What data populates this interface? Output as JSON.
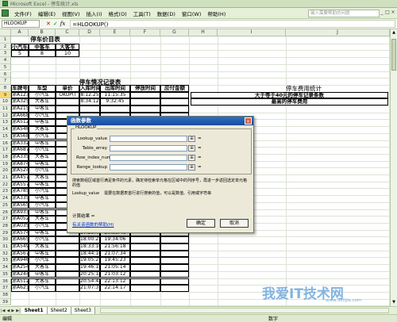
{
  "window": {
    "title": "Microsoft Excel - 停车统计.xls"
  },
  "menu": {
    "items": [
      "文件(F)",
      "编辑(E)",
      "视图(V)",
      "插入(I)",
      "格式(O)",
      "工具(T)",
      "数据(D)",
      "窗口(W)",
      "帮助(H)"
    ],
    "help_placeholder": "键入需要帮助的问题",
    "win_buttons": [
      "_",
      "□",
      "×"
    ]
  },
  "formula_bar": {
    "name_box": "HLOOKUP",
    "cancel_glyph": "✕",
    "enter_glyph": "✓",
    "fx_glyph": "fx",
    "formula": "=HLOOKUP()"
  },
  "columns": [
    "A",
    "B",
    "C",
    "D",
    "E",
    "F",
    "G",
    "H",
    "I",
    "J"
  ],
  "rows": [
    "1",
    "2",
    "3",
    "4",
    "5",
    "6",
    "7",
    "8",
    "9",
    "10",
    "11",
    "12",
    "13",
    "14",
    "15",
    "16",
    "17",
    "18",
    "19",
    "20",
    "21",
    "22",
    "23",
    "24",
    "25",
    "26",
    "27",
    "28",
    "29",
    "30",
    "31",
    "32",
    "33",
    "34",
    "35",
    "36",
    "37",
    "38",
    "39"
  ],
  "price_table": {
    "title": "停车价目表",
    "headers": [
      "小汽车",
      "中客车",
      "大客车"
    ],
    "values": [
      "5",
      "8",
      "10"
    ]
  },
  "record_table": {
    "title": "停车情况记录表",
    "headers": [
      "车牌号",
      "车型",
      "单价",
      "入库时间",
      "出库时间",
      "停放时间",
      "应付金额"
    ],
    "rows": [
      [
        "浙A12345",
        "小汽车",
        "OKUP()",
        "8:12:25",
        "11:15:35"
      ],
      [
        "浙A32581",
        "大客车",
        "",
        "8:34:12",
        "9:32:45"
      ],
      [
        "浙A21584",
        "中客车",
        "",
        "",
        ""
      ],
      [
        "浙A66871",
        "小汽车",
        "",
        "",
        ""
      ],
      [
        "浙A51271",
        "中客车",
        "",
        "",
        ""
      ],
      [
        "浙A54844",
        "大客车",
        "",
        "",
        ""
      ],
      [
        "浙A56894",
        "小汽车",
        "",
        "",
        ""
      ],
      [
        "浙A33221",
        "中客车",
        "",
        "",
        ""
      ],
      [
        "浙A68721",
        "小汽车",
        "",
        "",
        ""
      ],
      [
        "浙A33547",
        "大客车",
        "",
        "",
        ""
      ],
      [
        "浙A87412",
        "中客车",
        "",
        "",
        ""
      ],
      [
        "浙A52485",
        "小汽车",
        "",
        "",
        ""
      ],
      [
        "浙A45742",
        "大客车",
        "",
        "",
        ""
      ],
      [
        "浙A55711",
        "中客车",
        "",
        "",
        ""
      ],
      [
        "浙A78546",
        "小汽车",
        "",
        "",
        ""
      ],
      [
        "浙A33551",
        "中客车",
        "",
        "",
        ""
      ],
      [
        "浙A56587",
        "小汽车",
        "",
        "",
        ""
      ],
      [
        "浙A93355",
        "中客车",
        "",
        "",
        ""
      ],
      [
        "浙A05258",
        "大客车",
        "",
        "16:42:17",
        "21:05:14"
      ],
      [
        "浙A03552",
        "小汽车",
        "",
        "16:52:49",
        "19:03:00"
      ],
      [
        "浙A57484",
        "中客车",
        "",
        "17:29:49",
        "20:38:48"
      ],
      [
        "浙A66565",
        "小汽车",
        "",
        "18:00:21",
        "19:34:06"
      ],
      [
        "浙A54912",
        "大客车",
        "",
        "18:33:16",
        "21:56:18"
      ],
      [
        "浙A56786",
        "中客车",
        "",
        "18:44:16",
        "21:07:34"
      ],
      [
        "浙A94658",
        "小汽车",
        "",
        "19:05:21",
        "19:45:23"
      ],
      [
        "浙A25423",
        "大客车",
        "",
        "19:46:12",
        "21:05:14"
      ],
      [
        "浙A24422",
        "中客车",
        "",
        "20:25:14",
        "21:03:12"
      ],
      [
        "浙A51214",
        "大客车",
        "",
        "20:54:43",
        "22:13:12"
      ],
      [
        "浙A62347",
        "小汽车",
        "",
        "21:07:37",
        "22:14:17"
      ]
    ]
  },
  "stats": {
    "title": "停车费用统计",
    "row1": "大于等于40元的停车记录条数",
    "row2": "最高的停车费用"
  },
  "dialog": {
    "title": "函数参数",
    "close_glyph": "×",
    "group_label": "HLOOKUP",
    "args": [
      "Lookup_value",
      "Table_array",
      "Row_index_num",
      "Range_lookup"
    ],
    "arg_btn_glyph": "⊞",
    "eq": "=",
    "desc1": "搜索数组区域首行满足条件的元素，确定待检索单元格在区域中的列序号，再进一步返回选定单元格的值",
    "desc2_label": "Lookup_value",
    "desc2": "需要在数据表首行进行搜索的值，可以是数值、引用或字符串",
    "result_label": "计算结果 =",
    "help_link": "有关该函数的帮助(H)",
    "ok": "确定",
    "cancel": "取消"
  },
  "tabs": {
    "nav": [
      "|◀",
      "◀",
      "▶",
      "▶|"
    ],
    "sheets": [
      "Sheet1",
      "Sheet2",
      "Sheet3"
    ]
  },
  "status": {
    "left": "编辑",
    "right": "数字"
  },
  "watermark": {
    "main": "我爱IT技术网",
    "sub": "www.52itjie.com"
  }
}
